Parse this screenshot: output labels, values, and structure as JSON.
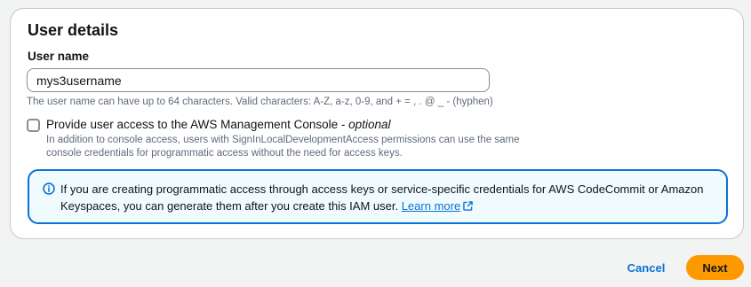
{
  "colors": {
    "accent": "#0972d3",
    "primary_button": "#ff9900",
    "alert_background": "#f0fbff",
    "secondary_text": "#5f6b7a"
  },
  "user_details": {
    "title": "User details",
    "user_name": {
      "label": "User name",
      "value": "mys3username",
      "constraint": "The user name can have up to 64 characters. Valid characters: A-Z, a-z, 0-9, and + = , . @ _ - (hyphen)"
    },
    "console_access": {
      "checked": false,
      "label": "Provide user access to the AWS Management Console - ",
      "optional": "optional",
      "description": "In addition to console access, users with SignInLocalDevelopmentAccess permissions can use the same console credentials for programmatic access without the need for access keys."
    },
    "info_alert": {
      "icon": "info-icon",
      "text": "If you are creating programmatic access through access keys or service-specific credentials for AWS CodeCommit or Amazon Keyspaces, you can generate them after you create this IAM user. ",
      "link": "Learn more",
      "link_icon": "external-link-icon"
    }
  },
  "actions": {
    "cancel": "Cancel",
    "next": "Next"
  }
}
